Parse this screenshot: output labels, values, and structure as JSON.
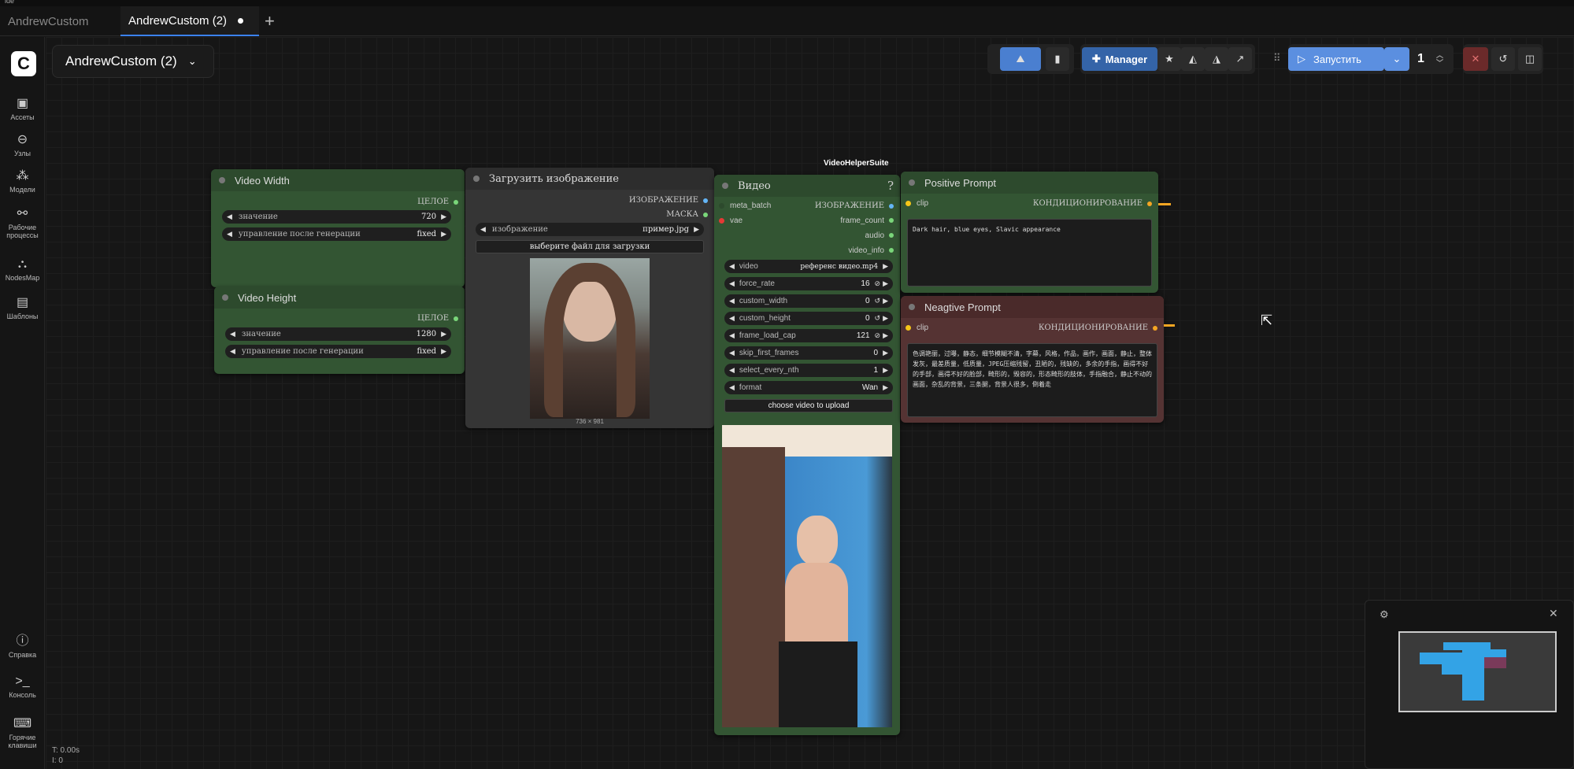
{
  "topstrip": {
    "label": "ide"
  },
  "tabs": [
    {
      "label": "AndrewCustom"
    },
    {
      "label": "AndrewCustom (2)"
    }
  ],
  "sidebar": {
    "items": [
      {
        "label": "Ассеты",
        "icon": "image-icon"
      },
      {
        "label": "Узлы",
        "icon": "node-icon"
      },
      {
        "label": "Модели",
        "icon": "models-icon"
      },
      {
        "label": "Рабочие процессы",
        "icon": "workflow-icon"
      },
      {
        "label": "NodesMap",
        "icon": "nodesmap-icon"
      },
      {
        "label": "Шаблоны",
        "icon": "templates-icon"
      },
      {
        "label": "Справка",
        "icon": "help-icon"
      },
      {
        "label": "Консоль",
        "icon": "console-icon"
      },
      {
        "label": "Горячие клавиши",
        "icon": "keyboard-icon"
      }
    ]
  },
  "workflow": {
    "title": "AndrewCustom (2)"
  },
  "toolbar": {
    "manager_label": "Manager",
    "run_label": "Запустить",
    "queue_count": "1"
  },
  "nodes": {
    "video_width": {
      "title": "Video Width",
      "output": "ЦЕЛОЕ",
      "w1_label": "значение",
      "w1_value": "720",
      "w2_label": "управление после генерации",
      "w2_value": "fixed"
    },
    "video_height": {
      "title": "Video Height",
      "output": "ЦЕЛОЕ",
      "w1_label": "значение",
      "w1_value": "1280",
      "w2_label": "управление после генерации",
      "w2_value": "fixed"
    },
    "load_image": {
      "title": "Загрузить изображение",
      "out1": "ИЗОБРАЖЕНИЕ",
      "out2": "МАСКА",
      "w1_label": "изображение",
      "w1_value": "пример.jpg",
      "upload": "выберите файл для загрузки",
      "size": "736 × 981"
    },
    "video": {
      "suite": "VideoHelperSuite",
      "title": "Видео",
      "help": "?",
      "in1": "meta_batch",
      "in2": "vae",
      "out1": "ИЗОБРАЖЕНИЕ",
      "out2": "frame_count",
      "out3": "audio",
      "out4": "video_info",
      "widgets": [
        {
          "label": "video",
          "value": "референс видео.mp4"
        },
        {
          "label": "force_rate",
          "value": "16"
        },
        {
          "label": "custom_width",
          "value": "0"
        },
        {
          "label": "custom_height",
          "value": "0"
        },
        {
          "label": "frame_load_cap",
          "value": "121"
        },
        {
          "label": "skip_first_frames",
          "value": "0"
        },
        {
          "label": "select_every_nth",
          "value": "1"
        },
        {
          "label": "format",
          "value": "Wan"
        }
      ],
      "upload": "choose video to upload"
    },
    "positive": {
      "title": "Positive Prompt",
      "in": "clip",
      "out": "КОНДИЦИОНИРОВАНИЕ",
      "text": "Dark hair, blue eyes, Slavic appearance"
    },
    "negative": {
      "title": "Neagtive Prompt",
      "in": "clip",
      "out": "КОНДИЦИОНИРОВАНИЕ",
      "text": "色调艳丽，过曝，静态，细节模糊不清，字幕，风格，作品，画作，画面，静止，整体发灰，最差质量，低质量，JPEG压缩残留，丑陋的，残缺的，多余的手指，画得不好的手部，画得不好的脸部，畸形的，毁容的，形态畸形的肢体，手指融合，静止不动的画面，杂乱的背景，三条腿，背景人很多，倒着走"
    }
  },
  "status": {
    "line1": "T: 0.00s",
    "line2": "I: 0"
  },
  "colors": {
    "accent": "#3b82f6",
    "node_green": "#335533",
    "node_red": "#553333",
    "node_gray": "#353535"
  }
}
